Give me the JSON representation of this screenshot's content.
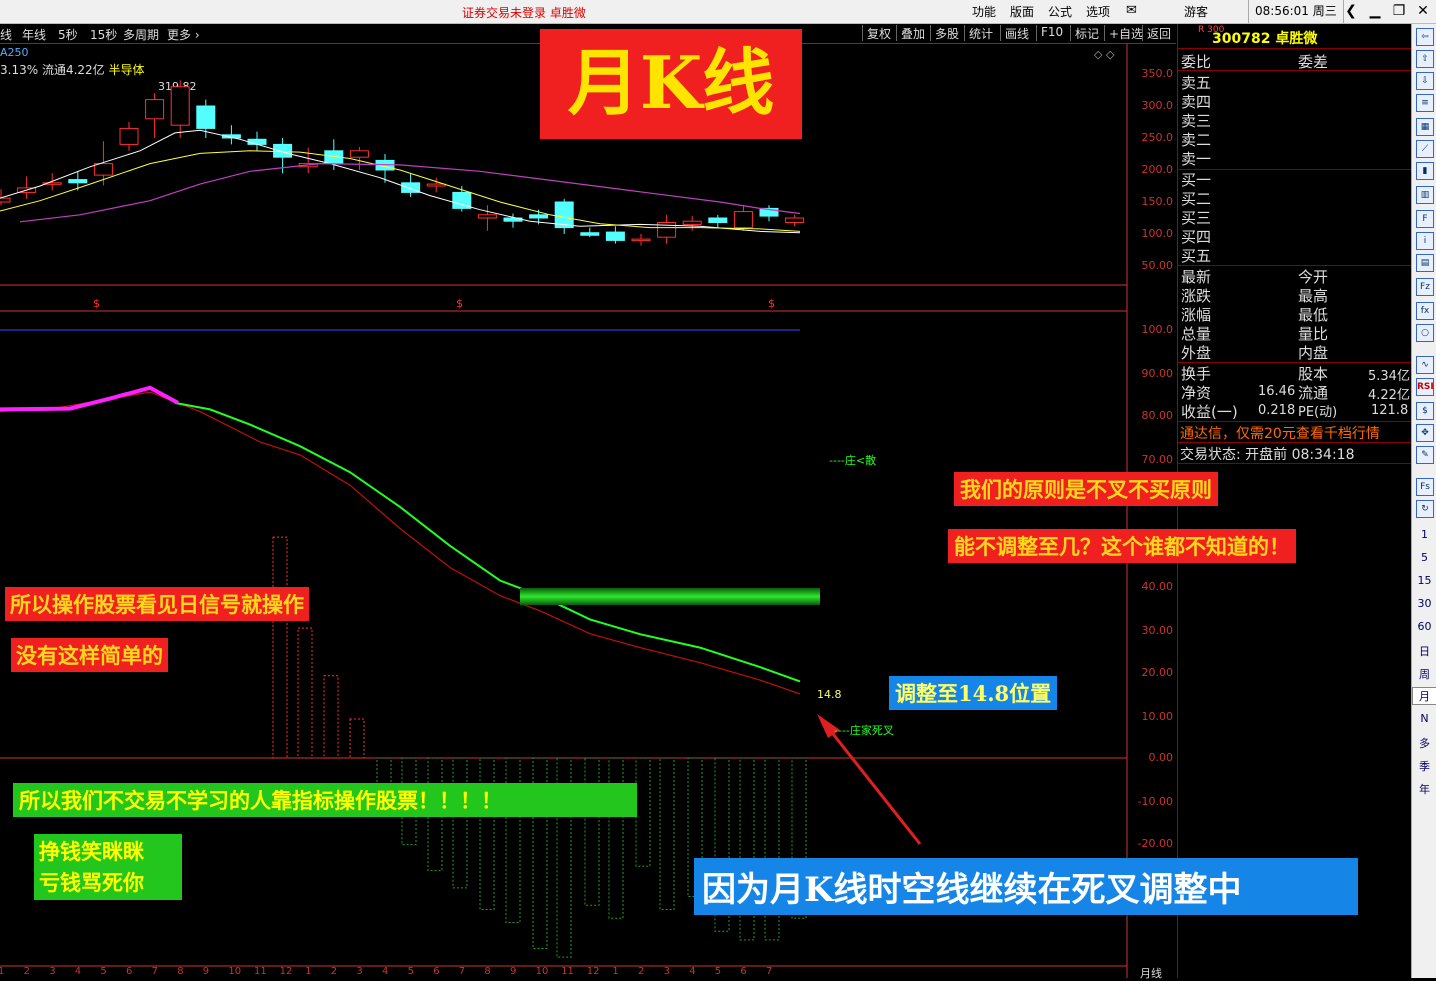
{
  "window": {
    "title": "证券交易未登录  卓胜微",
    "menus": [
      "功能",
      "版面",
      "公式",
      "选项"
    ],
    "user": "游客",
    "clock": "08:56:01 周三",
    "controls": {
      "back": "❮",
      "minimize": "▁",
      "restore": "❐",
      "close": "✕"
    }
  },
  "periods": [
    "线",
    "年线",
    "5秒",
    "15秒",
    "多周期",
    "更多 ›"
  ],
  "tools": [
    "复权",
    "叠加",
    "多股",
    "统计",
    "画线",
    "F10",
    "标记",
    "+自选",
    "返回"
  ],
  "stock_info": {
    "ma_tag": "A250",
    "change": "3.13%",
    "float": "流通4.22亿",
    "industry": "半导体",
    "max_label": "319.82"
  },
  "price_axis": [
    "350.0",
    "300.0",
    "250.0",
    "200.0",
    "150.0",
    "100.0",
    "50.00"
  ],
  "indicator_axis": [
    "100.0",
    "90.00",
    "80.00",
    "70.00",
    "40.00",
    "30.00",
    "20.00",
    "10.00",
    "0.00",
    "-10.00",
    "-20.00"
  ],
  "axis_bottom_label": "月线",
  "x_labels": [
    "1",
    "2",
    "3",
    "4",
    "5",
    "6",
    "7",
    "8",
    "9",
    "10",
    "11",
    "12",
    "1",
    "2",
    "3",
    "4",
    "5",
    "6",
    "7",
    "8",
    "9",
    "10",
    "11",
    "12",
    "1",
    "2",
    "3",
    "4",
    "5",
    "6",
    "7"
  ],
  "indicator_labels": {
    "top": "----庄<散",
    "bottom": "----庄家死叉",
    "value": "14.8"
  },
  "panel": {
    "code_badge": "R 300",
    "code": "300782",
    "name": "卓胜微",
    "weibi": "委比",
    "weicha": "委差",
    "sell": [
      "卖五",
      "卖四",
      "卖三",
      "卖二",
      "卖一"
    ],
    "buy": [
      "买一",
      "买二",
      "买三",
      "买四",
      "买五"
    ],
    "stats_left": [
      "最新",
      "涨跌",
      "涨幅",
      "总量",
      "外盘"
    ],
    "stats_right": [
      "今开",
      "最高",
      "最低",
      "量比",
      "内盘"
    ],
    "fin": [
      {
        "l": "换手",
        "v": "",
        "r": "股本",
        "rv": "5.34亿"
      },
      {
        "l": "净资",
        "v": "16.46",
        "r": "流通",
        "rv": "4.22亿"
      },
      {
        "l": "收益(一)",
        "v": "0.218",
        "r": "PE(动)",
        "rv": "121.8"
      }
    ],
    "promo": "通达信，仅需20元查看千档行情",
    "status": "交易状态: 开盘前 08:34:18"
  },
  "side_periods": [
    "1",
    "5",
    "15",
    "30",
    "60",
    "日",
    "周",
    "月",
    "N",
    "多",
    "季",
    "年"
  ],
  "side_icons": [
    "RSI"
  ],
  "overlays": {
    "title": "月K线",
    "principle": "我们的原则是不叉不买原则",
    "question": "能不调整至几？这个谁都不知道的！",
    "op1": "所以操作股票看见日信号就操作",
    "op2": "没有这样简单的",
    "adjust": "调整至14.8位置",
    "indicator_msg": "所以我们不交易不学习的人靠指标操作股票！！！！",
    "joke1": "挣钱笑眯眯",
    "joke2": "亏钱骂死你",
    "bottom_msg": "因为月K线时空线继续在死叉调整中"
  },
  "colors": {
    "up": "#ff3030",
    "down": "#54ffff",
    "ma5": "#ffffff",
    "ma10": "#ffff40",
    "ma250": "#c040c0",
    "fast_line": "#22ff22",
    "slow_line": "#c01010",
    "highlight": "#ff20ff"
  }
}
